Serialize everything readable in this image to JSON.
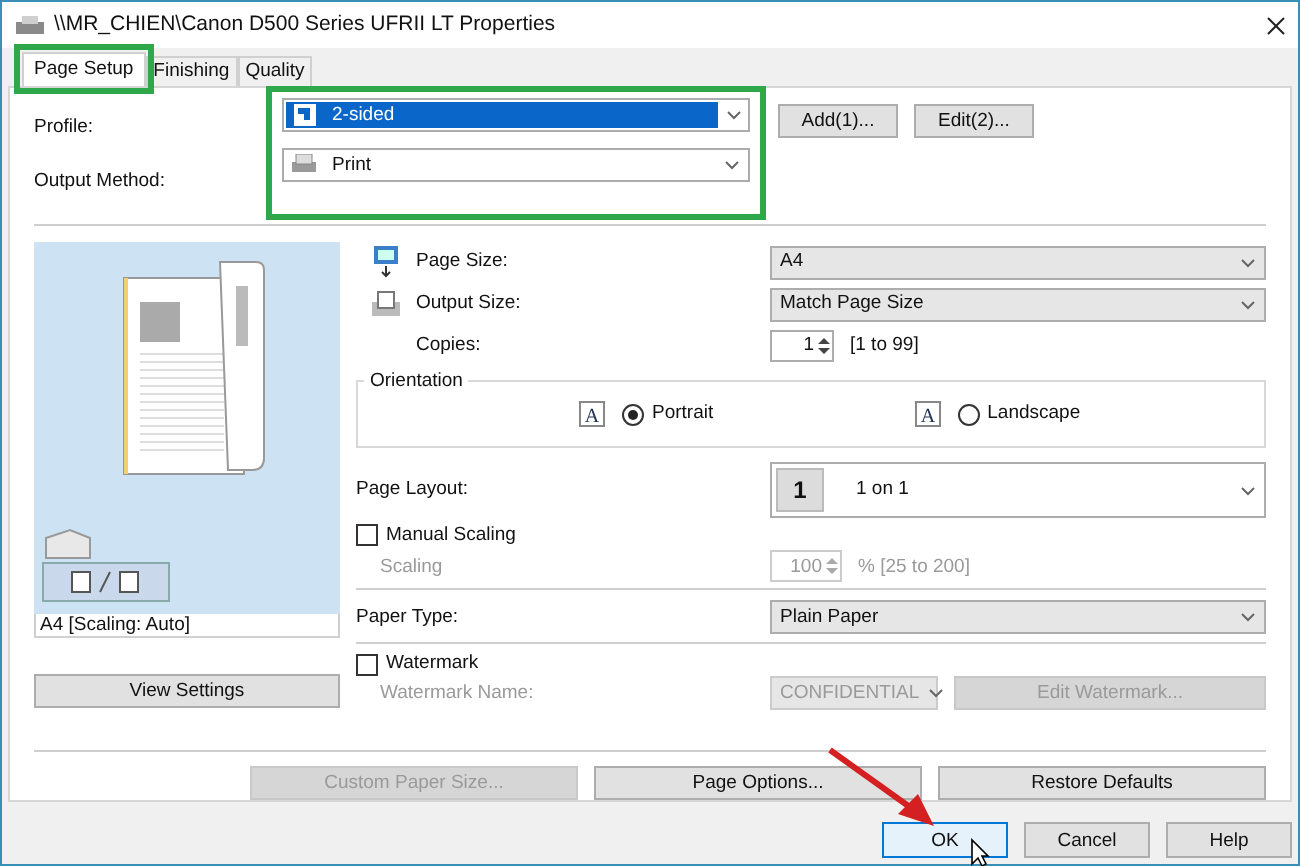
{
  "window": {
    "title": "\\\\MR_CHIEN\\Canon D500 Series UFRII LT Properties"
  },
  "tabs": [
    {
      "label": "Page Setup",
      "selected": true
    },
    {
      "label": "Finishing",
      "selected": false
    },
    {
      "label": "Quality",
      "selected": false
    }
  ],
  "profile": {
    "label": "Profile:",
    "value": "2-sided",
    "buttons": [
      "Add(1)...",
      "Edit(2)..."
    ]
  },
  "output_method": {
    "label": "Output Method:",
    "value": "Print"
  },
  "preview": {
    "caption": "A4 [Scaling: Auto]",
    "button": "View Settings"
  },
  "page_size": {
    "label": "Page Size:",
    "value": "A4"
  },
  "output_size": {
    "label": "Output Size:",
    "value": "Match Page Size"
  },
  "copies": {
    "label": "Copies:",
    "value": "1",
    "range": "[1 to 99]"
  },
  "orientation": {
    "title": "Orientation",
    "options": [
      {
        "label": "Portrait",
        "icon_text": "A",
        "selected": true
      },
      {
        "label": "Landscape",
        "icon_text": "A",
        "selected": false
      }
    ]
  },
  "page_layout": {
    "label": "Page Layout:",
    "number": "1",
    "value": "1 on 1"
  },
  "manual_scaling": {
    "label": "Manual Scaling",
    "checked": false
  },
  "scaling": {
    "label": "Scaling",
    "value": "100",
    "range": "% [25 to 200]",
    "disabled": true
  },
  "paper_type": {
    "label": "Paper Type:",
    "value": "Plain Paper"
  },
  "watermark": {
    "label": "Watermark",
    "checked": false
  },
  "watermark_name": {
    "label": "Watermark Name:",
    "value": "CONFIDENTIAL",
    "button": "Edit Watermark...",
    "disabled": true
  },
  "bottom_buttons": [
    {
      "label": "Custom Paper Size...",
      "disabled": true
    },
    {
      "label": "Page Options...",
      "disabled": false
    },
    {
      "label": "Restore Defaults",
      "disabled": false
    }
  ],
  "dialog_buttons": [
    {
      "label": "OK",
      "focused": true
    },
    {
      "label": "Cancel",
      "focused": false
    },
    {
      "label": "Help",
      "focused": false
    }
  ]
}
